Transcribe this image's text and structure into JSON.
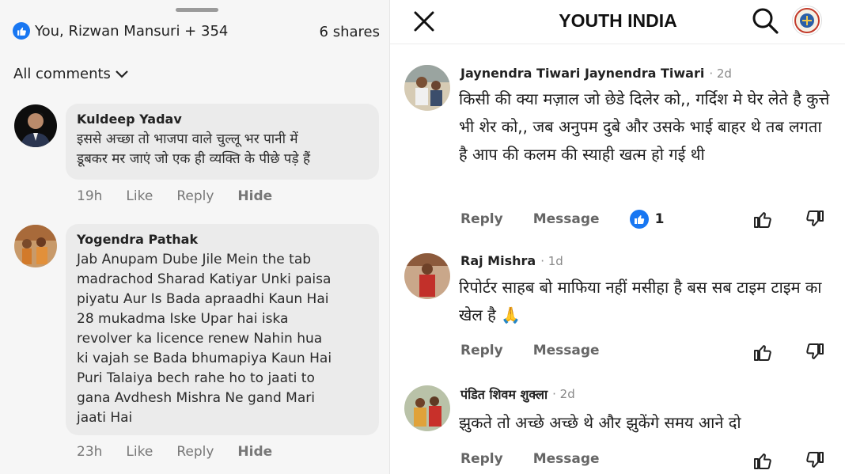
{
  "left_panel": {
    "reactions_text": "You, Rizwan Mansuri + 354",
    "shares_text": "6 shares",
    "all_comments_label": "All comments",
    "comments": [
      {
        "name": "Kuldeep Yadav",
        "text": "इससे अच्छा तो भाजपा वाले चुल्लू भर पानी में\nडूबकर मर जाएं जो एक ही व्यक्ति के पीछे पड़े हैं",
        "time": "19h",
        "like": "Like",
        "reply": "Reply",
        "hide": "Hide"
      },
      {
        "name": "Yogendra Pathak",
        "text": "Jab Anupam Dube Jile Mein the tab\nmadrachod Sharad Katiyar Unki paisa\npiyatu Aur Is Bada apraadhi Kaun Hai\n28 mukadma Iske Upar hai iska\nrevolver ka licence renew Nahin hua\nki vajah se Bada bhumapiya Kaun Hai\nPuri Talaiya bech rahe ho to jaati to\ngana Avdhesh Mishra Ne gand Mari\njaati Hai",
        "time": "23h",
        "like": "Like",
        "reply": "Reply",
        "hide": "Hide"
      }
    ]
  },
  "right_panel": {
    "title": "YOUTH INDIA",
    "comments": [
      {
        "name": "Jaynendra Tiwari Jaynendra Tiwari",
        "time": "· 2d",
        "text": "किसी की क्या मज़ाल जो छेडे दिलेर को,, गर्दिश मे घेर लेते है कुत्ते भी शेर को,, जब अनुपम दुबे और उसके भाई बाहर थे तब लगता है आप की कलम की स्याही खत्म हो गई थी",
        "reply": "Reply",
        "message": "Message",
        "reaction_count": "1"
      },
      {
        "name": "Raj Mishra",
        "time": "· 1d",
        "text": "रिपोर्टर साहब बो माफिया नहीं मसीहा है बस सब टाइम टाइम का खेल है 🙏",
        "reply": "Reply",
        "message": "Message"
      },
      {
        "name": "पंडित शिवम शुक्ला",
        "time": "· 2d",
        "text": "झुकते तो अच्छे अच्छे थे और झुकेंगे समय आने दो",
        "reply": "Reply",
        "message": "Message"
      }
    ]
  },
  "colors": {
    "facebook_blue": "#1877f2",
    "bubble_gray": "#ebebeb",
    "muted_text": "#777777"
  }
}
